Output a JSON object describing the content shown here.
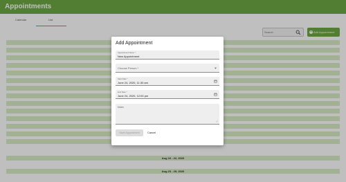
{
  "app": {
    "title": "Appointments"
  },
  "tabs": [
    {
      "label": "Calendar",
      "active": false
    },
    {
      "label": "List",
      "active": true
    }
  ],
  "toolbar": {
    "search_placeholder": "Search",
    "add_label": "Add Appointment"
  },
  "list": {
    "visible_weeks": [
      "Aug 16 - 22, 2020",
      "Aug 23 - 29, 2020"
    ]
  },
  "dialog": {
    "title": "Add Appointment",
    "name_label": "Appointment Name *",
    "name_value": "New Appointment",
    "person_placeholder": "Choose Person *",
    "start_label": "Start Date *",
    "start_value": "June 24, 2020, 11:30 am",
    "end_label": "End Date *",
    "end_value": "June 24, 2020, 12:00 pm",
    "notes_label": "Notes",
    "save_label": "Save Appointment",
    "cancel_label": "Cancel"
  },
  "colors": {
    "brand": "#6da843",
    "row_tint": "#d8ecc6"
  }
}
